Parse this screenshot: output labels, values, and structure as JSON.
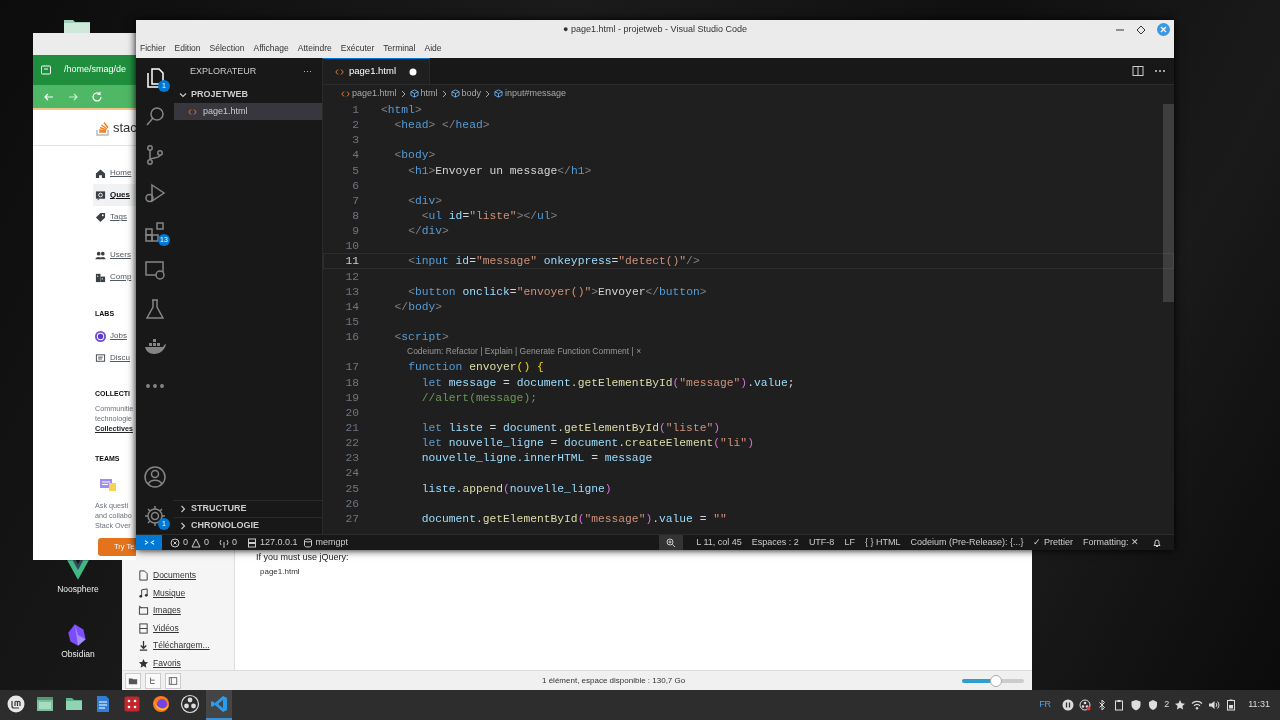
{
  "desktop": {
    "icons": [
      {
        "kind": "vue",
        "label": "Noosphere"
      },
      {
        "kind": "crystal",
        "label": "Obsidian"
      }
    ]
  },
  "browser": {
    "path": "/home/smag/de",
    "logo_text": "stac",
    "nav": [
      {
        "kind": "home",
        "label": "Home",
        "selected": false
      },
      {
        "kind": "question",
        "label": "Ques",
        "selected": true
      },
      {
        "kind": "tag",
        "label": "Tags",
        "selected": false
      },
      {
        "kind": "users",
        "label": "Users",
        "selected": false
      },
      {
        "kind": "building",
        "label": "Comp",
        "selected": false
      }
    ],
    "labs": {
      "heading": "LABS",
      "items": [
        {
          "kind": "jobs",
          "label": "Jobs"
        },
        {
          "kind": "discuss",
          "label": "Discu"
        }
      ]
    },
    "collectives": {
      "heading": "COLLECTI",
      "lines": [
        "Communitie",
        "technologie"
      ],
      "link": "Collectives"
    },
    "teams": {
      "heading": "TEAMS",
      "lines": [
        "Ask questi",
        "and collabo",
        "Stack Over"
      ],
      "button": "Try Te"
    }
  },
  "files": {
    "sidebar": [
      {
        "kind": "document",
        "label": "Documents"
      },
      {
        "kind": "music",
        "label": "Musique"
      },
      {
        "kind": "images",
        "label": "Images"
      },
      {
        "kind": "video",
        "label": "Vidéos"
      },
      {
        "kind": "download",
        "label": "Téléchargem..."
      },
      {
        "kind": "star",
        "label": "Favoris"
      }
    ],
    "note": "If you must use jQuery:",
    "items": [
      "page1.html"
    ],
    "status": "1 élément, espace disponible : 130,7 Go",
    "zoom": {
      "level": 0.55
    }
  },
  "vscode": {
    "title": "● page1.html - projetweb - Visual Studio Code",
    "menu": [
      "Fichier",
      "Edition",
      "Sélection",
      "Affichage",
      "Atteindre",
      "Exécuter",
      "Terminal",
      "Aide"
    ],
    "activity": [
      {
        "kind": "explorer",
        "badge": "1",
        "selected": true
      },
      {
        "kind": "search",
        "selected": false
      },
      {
        "kind": "git",
        "selected": false
      },
      {
        "kind": "debug",
        "selected": false
      },
      {
        "kind": "extensions",
        "badge": "13",
        "selected": false
      },
      {
        "kind": "remote",
        "selected": false
      },
      {
        "kind": "testing",
        "selected": false
      },
      {
        "kind": "docker",
        "selected": false
      },
      {
        "kind": "more",
        "selected": false
      }
    ],
    "activity_bottom": [
      {
        "kind": "account"
      },
      {
        "kind": "settings",
        "badge": "1"
      }
    ],
    "explorer": {
      "title": "EXPLORATEUR",
      "more": "···",
      "folder": {
        "label": "PROJETWEB",
        "expanded": true,
        "files": [
          {
            "label": "page1.html",
            "selected": true
          }
        ]
      },
      "panels": [
        {
          "label": "STRUCTURE",
          "expanded": false
        },
        {
          "label": "CHRONOLOGIE",
          "expanded": false
        }
      ]
    },
    "tabs": [
      {
        "label": "page1.html",
        "modified": true,
        "selected": true
      }
    ],
    "breadcrumbs": [
      "page1.html",
      "html",
      "body",
      "input#message"
    ],
    "lines": [
      {
        "kind": "html",
        "number": "1",
        "current": false,
        "text": "<html>"
      },
      {
        "kind": "html",
        "number": "2",
        "current": false,
        "text": "  <head> </head>"
      },
      {
        "kind": "html",
        "number": "3",
        "current": false
      },
      {
        "kind": "html",
        "number": "4",
        "current": false,
        "text": "  <body>"
      },
      {
        "kind": "html",
        "number": "5",
        "current": false,
        "text": "    <h1>Envoyer un message</h1>"
      },
      {
        "kind": "html",
        "number": "6",
        "current": false
      },
      {
        "kind": "html",
        "number": "7",
        "current": false,
        "text": "    <div>"
      },
      {
        "kind": "html",
        "number": "8",
        "current": false,
        "text": "      <ul id=\"liste\"></ul>"
      },
      {
        "kind": "html",
        "number": "9",
        "current": false,
        "text": "    </div>"
      },
      {
        "kind": "html",
        "number": "10",
        "current": false
      },
      {
        "kind": "html",
        "number": "11",
        "current": true,
        "text": "    <input id=\"message\" onkeypress=\"detect()\"/>"
      },
      {
        "kind": "html",
        "number": "12",
        "current": false
      },
      {
        "kind": "html",
        "number": "13",
        "current": false,
        "text": "    <button onclick=\"envoyer()\">Envoyer</button>"
      },
      {
        "kind": "html",
        "number": "14",
        "current": false,
        "text": "  </body>"
      },
      {
        "kind": "html",
        "number": "15",
        "current": false
      },
      {
        "kind": "html",
        "number": "16",
        "current": false,
        "text": "  <script>"
      },
      {
        "kind": "lens",
        "text": "Codeium: Refactor | Explain | Generate Function Comment | ×"
      },
      {
        "kind": "js",
        "number": "17",
        "current": false,
        "text": "    function envoyer() {"
      },
      {
        "kind": "js",
        "number": "18",
        "current": false,
        "text": "      let message = document.getElementById(\"message\").value;"
      },
      {
        "kind": "js",
        "number": "19",
        "current": false,
        "text": "      //alert(message);"
      },
      {
        "kind": "js",
        "number": "20",
        "current": false
      },
      {
        "kind": "js",
        "number": "21",
        "current": false,
        "text": "      let liste = document.getElementById(\"liste\")"
      },
      {
        "kind": "js",
        "number": "22",
        "current": false,
        "text": "      let nouvelle_ligne = document.createElement(\"li\")"
      },
      {
        "kind": "js",
        "number": "23",
        "current": false,
        "text": "      nouvelle_ligne.innerHTML = message"
      },
      {
        "kind": "js",
        "number": "24",
        "current": false
      },
      {
        "kind": "js",
        "number": "25",
        "current": false,
        "text": "      liste.append(nouvelle_ligne)"
      },
      {
        "kind": "js",
        "number": "26",
        "current": false
      },
      {
        "kind": "js",
        "number": "27",
        "current": false,
        "text": "      document.getElementById(\"message\").value = \"\""
      }
    ],
    "status": {
      "errors": "0",
      "warnings": "0",
      "ports": "0",
      "host": "127.0.0.1",
      "db": "memgpt",
      "position": "L 11, col 45",
      "indent": "Espaces : 2",
      "encoding": "UTF-8",
      "eol": "LF",
      "language": "{ } HTML",
      "codeium": "Codeium (Pre-Release): {...}",
      "prettier": "✓ Prettier",
      "formatting": "Formatting: ✕"
    }
  },
  "taskbar": {
    "apps": [
      {
        "kind": "mint",
        "selected": false
      },
      {
        "kind": "window",
        "selected": false
      },
      {
        "kind": "folder",
        "selected": false
      },
      {
        "kind": "writer",
        "selected": false
      },
      {
        "kind": "dice",
        "selected": false
      },
      {
        "kind": "firefox",
        "selected": false
      },
      {
        "kind": "obs",
        "selected": false
      },
      {
        "kind": "vscode",
        "selected": true
      }
    ],
    "lang": "FR",
    "tray": [
      {
        "kind": "pause"
      },
      {
        "kind": "obs"
      },
      {
        "kind": "bluetooth"
      },
      {
        "kind": "clipboard"
      },
      {
        "kind": "shield"
      },
      {
        "kind": "updates",
        "count": "2"
      },
      {
        "kind": "star"
      },
      {
        "kind": "wifi"
      },
      {
        "kind": "volume"
      },
      {
        "kind": "power"
      }
    ],
    "clock": "11:31"
  }
}
